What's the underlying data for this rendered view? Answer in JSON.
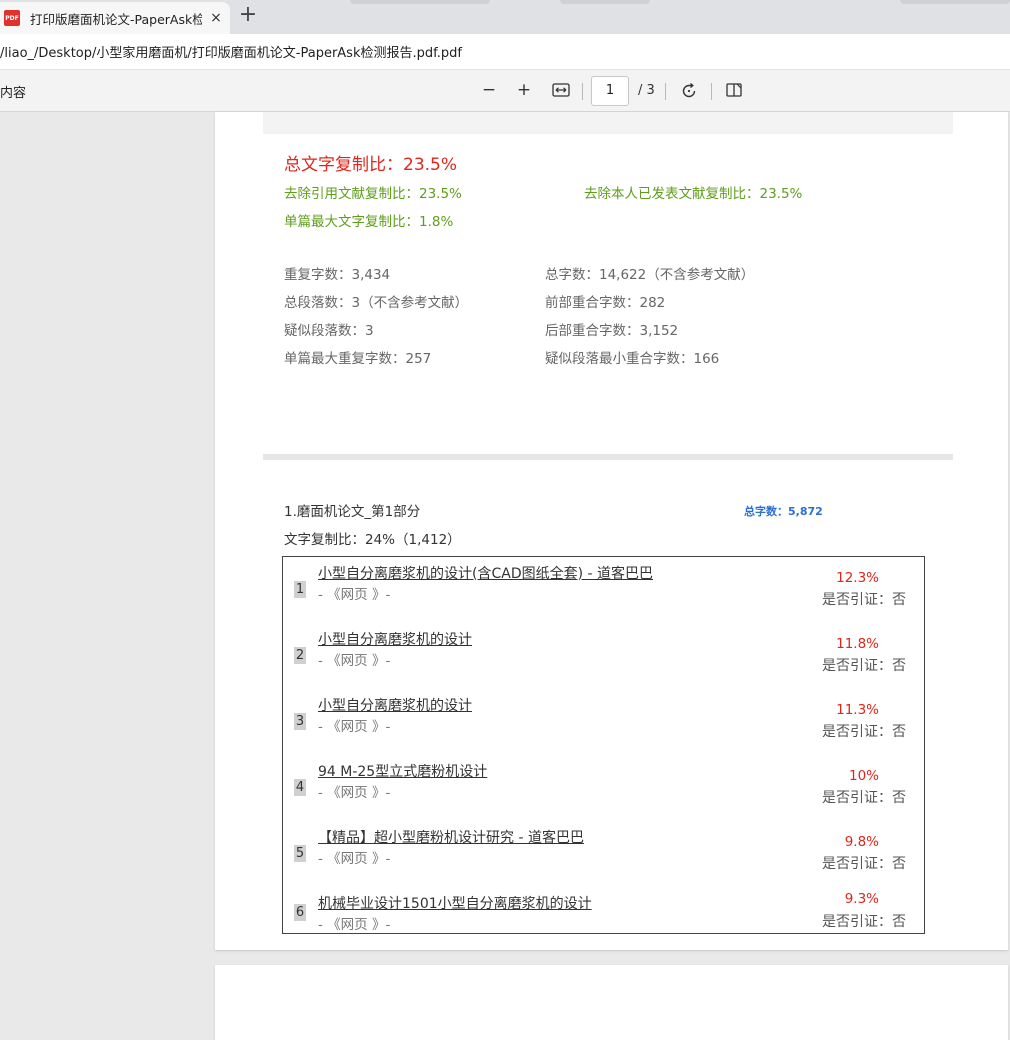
{
  "browser": {
    "tab_title": "打印版磨面机论文-PaperAsk检测",
    "tab_close": "×",
    "new_tab": "+",
    "address": "/liao_/Desktop/小型家用磨面机/打印版磨面机论文-PaperAsk检测报告.pdf.pdf",
    "pdf_badge": "PDF"
  },
  "toolbar": {
    "contents_label": "内容",
    "zoom_out": "−",
    "zoom_in": "+",
    "current_page": "1",
    "page_total": "/ 3"
  },
  "report": {
    "total_ratio": "总文字复制比：23.5%",
    "exclude_citation": "去除引用文献复制比：23.5%",
    "exclude_self": "去除本人已发表文献复制比：23.5%",
    "max_single": "单篇最大文字复制比：1.8%",
    "stats_left": [
      "重复字数：3,434",
      "总段落数：3（不含参考文献）",
      "疑似段落数：3",
      "单篇最大重复字数：257"
    ],
    "stats_right": [
      "总字数：14,622（不含参考文献）",
      "前部重合字数：282",
      "后部重合字数：3,152",
      "疑似段落最小重合字数：166"
    ]
  },
  "section": {
    "title": "1.磨面机论文_第1部分",
    "total_words": "总字数：5,872",
    "ratio": "文字复制比：24%（1,412）"
  },
  "references": [
    {
      "num": "1",
      "title": "小型自分离磨浆机的设计(含CAD图纸全套) - 道客巴巴",
      "source": "- 《网页 》-",
      "pct": "12.3%",
      "cite": "是否引证：否"
    },
    {
      "num": "2",
      "title": "小型自分离磨浆机的设计",
      "source": "- 《网页 》-",
      "pct": "11.8%",
      "cite": "是否引证：否"
    },
    {
      "num": "3",
      "title": "小型自分离磨浆机的设计",
      "source": "- 《网页 》-",
      "pct": "11.3%",
      "cite": "是否引证：否"
    },
    {
      "num": "4",
      "title": "94 M-25型立式磨粉机设计",
      "source": "- 《网页 》-",
      "pct": "10%",
      "cite": "是否引证：否"
    },
    {
      "num": "5",
      "title": "【精品】超小型磨粉机设计研究 - 道客巴巴",
      "source": "- 《网页 》-",
      "pct": "9.8%",
      "cite": "是否引证：否"
    },
    {
      "num": "6",
      "title": "机械毕业设计1501小型自分离磨浆机的设计",
      "source": "- 《网页 》-",
      "pct": "9.3%",
      "cite": "是否引证：否"
    }
  ]
}
